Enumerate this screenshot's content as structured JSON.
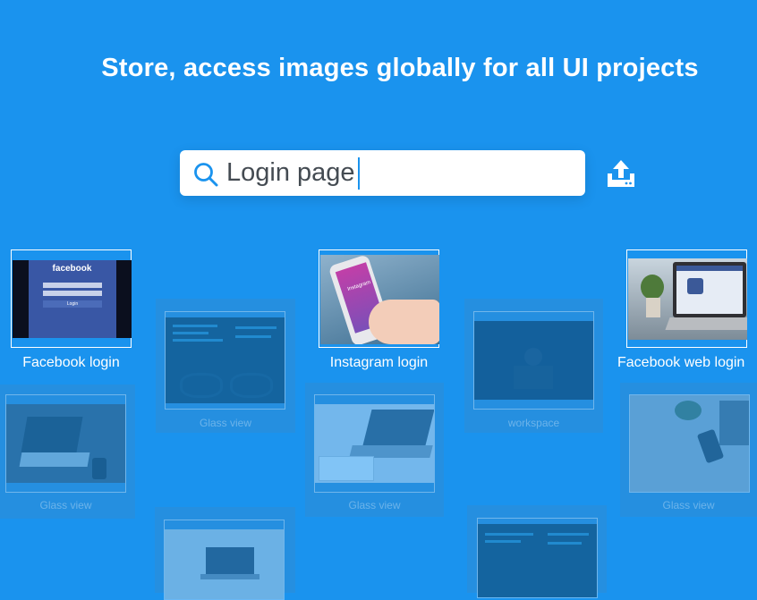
{
  "headline": "Store, access images globally for all UI projects",
  "search": {
    "value": "Login page",
    "icon": "search-icon"
  },
  "upload": {
    "icon": "upload-icon"
  },
  "cards": {
    "facebook_login": "Facebook login",
    "instagram_login": "Instagram login",
    "facebook_web_login": "Facebook web login",
    "glass_view_1": "Glass view",
    "workspace": "workspace",
    "glass_view_2": "Glass view",
    "glass_view_3": "Glass view",
    "glass_view_4": "Glass view"
  },
  "thumb_text": {
    "facebook": "facebook",
    "login": "Login",
    "instagram": "Instagram"
  },
  "colors": {
    "background": "#1a93ee",
    "accent": "#1a93ee"
  }
}
